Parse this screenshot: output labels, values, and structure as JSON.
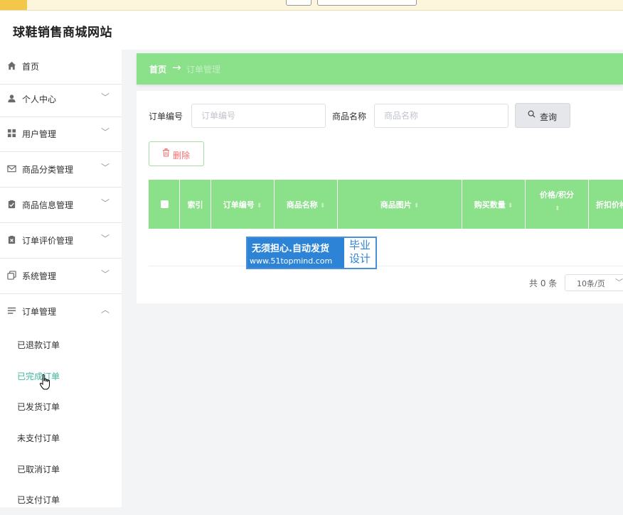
{
  "site": {
    "title": "球鞋销售商城网站"
  },
  "sidebar": {
    "items": [
      {
        "label": "首页",
        "icon": "home-icon",
        "expandable": false
      },
      {
        "label": "个人中心",
        "icon": "user-icon",
        "expandable": true
      },
      {
        "label": "用户管理",
        "icon": "grid-icon",
        "expandable": true
      },
      {
        "label": "商品分类管理",
        "icon": "envelope-icon",
        "expandable": true
      },
      {
        "label": "商品信息管理",
        "icon": "clipboard-check-icon",
        "expandable": true
      },
      {
        "label": "订单评价管理",
        "icon": "clipboard-x-icon",
        "expandable": true
      },
      {
        "label": "系统管理",
        "icon": "copy-icon",
        "expandable": true
      },
      {
        "label": "订单管理",
        "icon": "list-icon",
        "expandable": true,
        "expanded": true
      }
    ],
    "sub_items": [
      {
        "label": "已退款订单"
      },
      {
        "label": "已完成订单",
        "active": true
      },
      {
        "label": "已发货订单"
      },
      {
        "label": "未支付订单"
      },
      {
        "label": "已取消订单"
      },
      {
        "label": "已支付订单"
      }
    ]
  },
  "breadcrumb": {
    "home": "首页",
    "separator": "→",
    "current": "订单管理"
  },
  "filters": {
    "order_no_label": "订单编号",
    "order_no_placeholder": "订单编号",
    "product_name_label": "商品名称",
    "product_name_placeholder": "商品名称",
    "query_label": "查询"
  },
  "actions": {
    "delete_label": "删除"
  },
  "table": {
    "columns": [
      "索引",
      "订单编号",
      "商品名称",
      "商品图片",
      "购买数量",
      "价格/积分",
      "折扣价格"
    ],
    "rows": []
  },
  "pagination": {
    "total_text": "共 0 条",
    "page_size": "10条/页"
  },
  "watermark": {
    "line1": "无须担心.自动发货",
    "line2": "www.51topmind.com",
    "badge1": "毕业",
    "badge2": "设计"
  },
  "colors": {
    "accent": "#8be08a",
    "active_text": "#3db8a0",
    "danger": "#f56c6c"
  }
}
